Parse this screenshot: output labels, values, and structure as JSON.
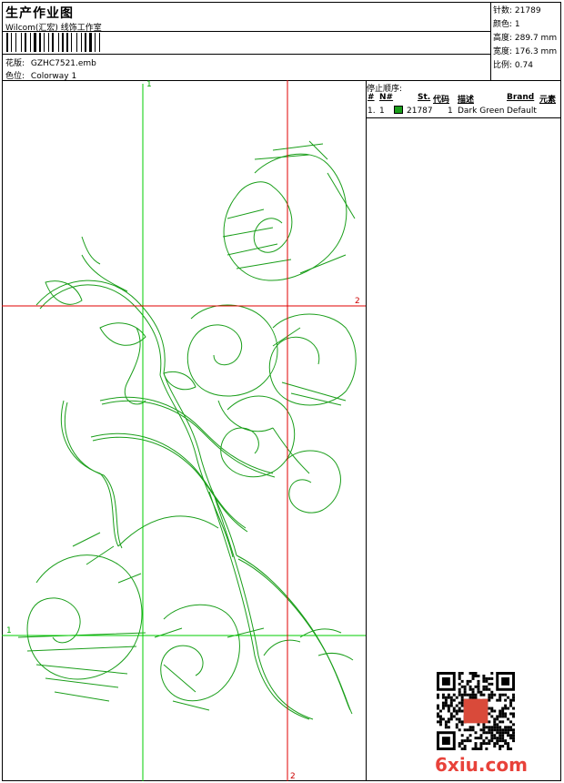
{
  "header": {
    "title": "生产作业图",
    "company": "Wilcom(汇宏) 线饰工作室",
    "design_label": "花版:",
    "design_value": "GZHC7521.emb",
    "colorway_label": "色位:",
    "colorway_value": "Colorway 1"
  },
  "stats": [
    {
      "label": "针数:",
      "value": "21789"
    },
    {
      "label": "颜色:",
      "value": "1"
    },
    {
      "label": "高度:",
      "value": "289.7 mm"
    },
    {
      "label": "宽度:",
      "value": "176.3 mm"
    },
    {
      "label": "比例:",
      "value": "0.74"
    }
  ],
  "stop_sequence": {
    "title": "停止顺序:",
    "columns": [
      "#",
      "N#",
      "St.",
      "代码",
      "描述",
      "Brand",
      "元素"
    ],
    "rows": [
      {
        "index": "1.",
        "needle": "1",
        "color": "#1a9e1a",
        "stitches": "21787",
        "code": "1",
        "description": "Dark Green",
        "brand": "Default",
        "element": ""
      }
    ]
  },
  "guides": {
    "v1_top": "1",
    "v2_bottom": "2",
    "h2_right": "2",
    "h1_left": "1"
  },
  "watermark": "6xiu.com",
  "colors": {
    "thread": "#1a9e1a",
    "guide_green": "#00cc00",
    "guide_red": "#e00000"
  }
}
